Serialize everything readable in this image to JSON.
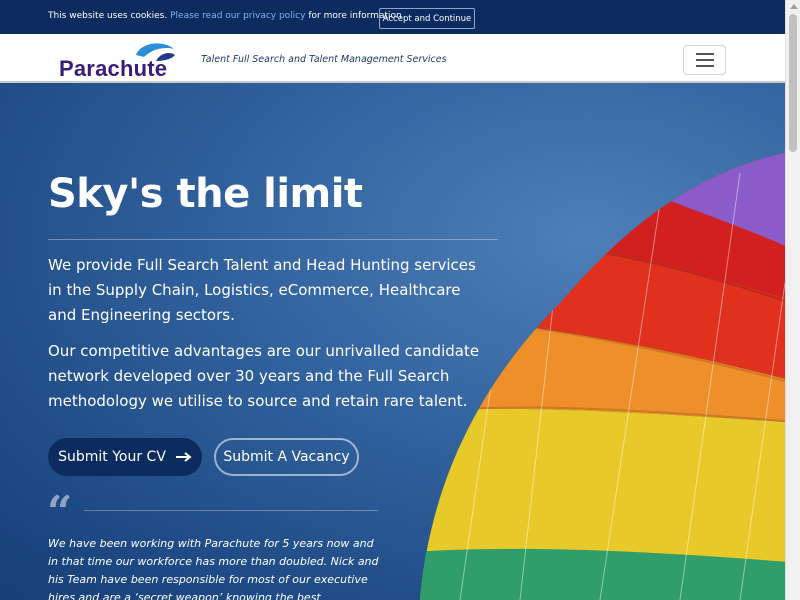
{
  "cookie": {
    "text_before": "This website uses cookies.",
    "link": "Please read our privacy policy",
    "text_after": "for more information",
    "button": "Accept and Continue"
  },
  "header": {
    "logo": "Parachute",
    "tagline": "Talent Full Search and Talent Management Services",
    "menu_icon": "hamburger-menu-icon"
  },
  "hero": {
    "title": "Sky's the limit",
    "paragraph_1": "We provide Full Search Talent and Head Hunting services in the Supply Chain, Logistics, eCommerce, Healthcare and Engineering sectors.",
    "paragraph_2": "Our competitive advantages are our unrivalled candidate network developed over 30 years and the Full Search methodology we utilise to source and retain rare talent.",
    "buttons": {
      "submit_cv": "Submit Your CV",
      "submit_cv_icon": "arrow-right-icon",
      "submit_vacancy": "Submit A Vacancy"
    },
    "quote_mark": "“",
    "testimonial": "We have been working with Parachute for 5 years now and in that time our workforce has more than doubled. Nick and his Team have been responsible for most of our executive hires and are a ‘secret weapon’ knowing the best candidates for our"
  },
  "colors": {
    "navy": "#0c2b5e",
    "logo_purple": "#3a1c7a",
    "hero_blue": "#2a5a96",
    "link_blue": "#7fb2f0"
  }
}
